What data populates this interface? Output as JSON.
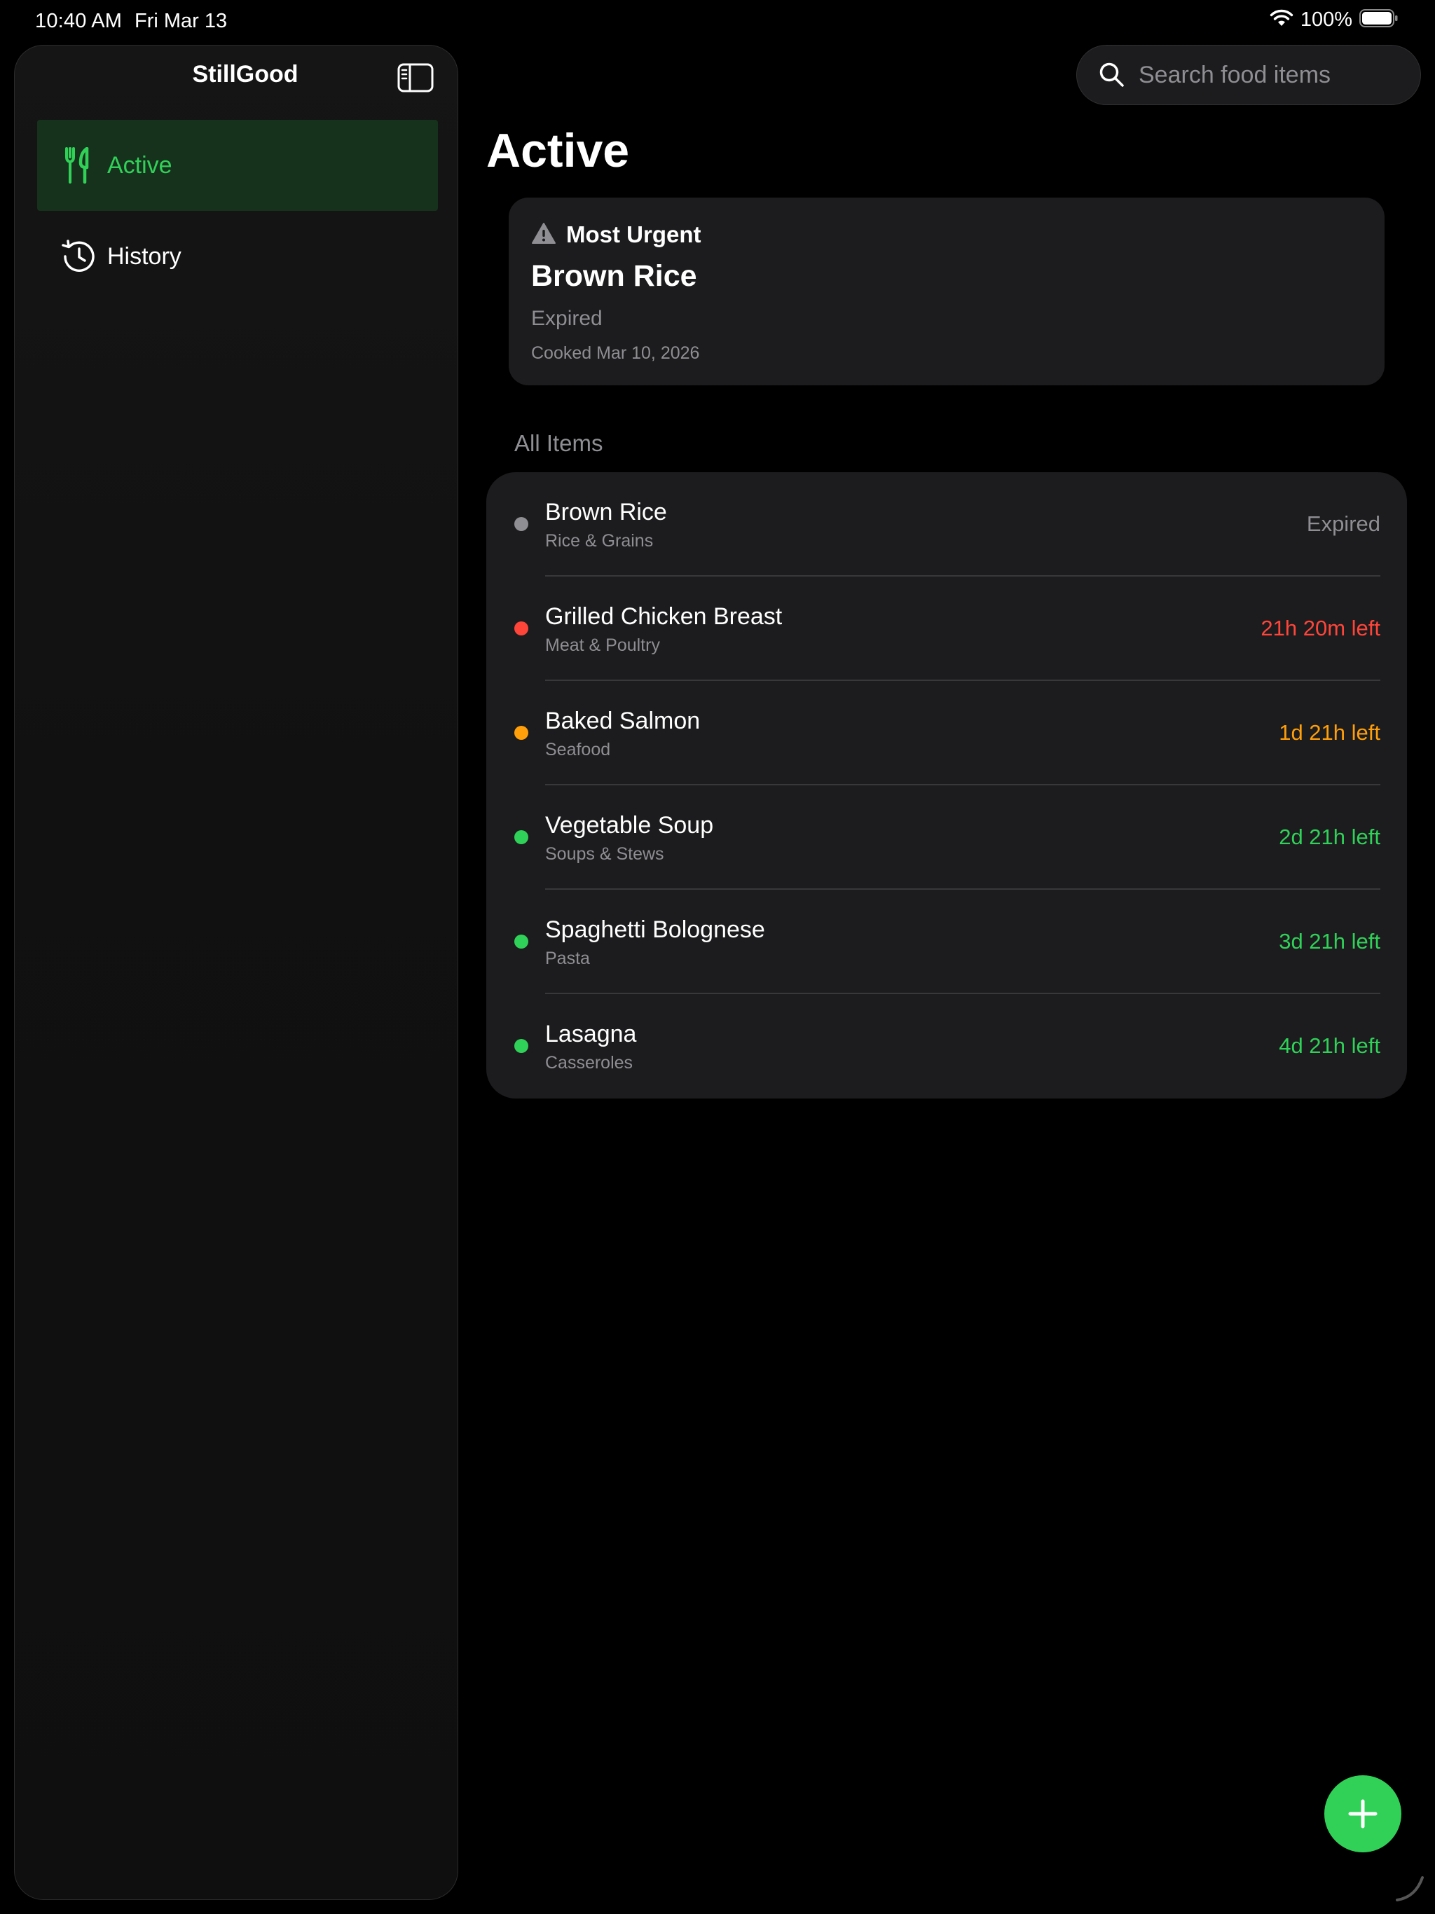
{
  "status_bar": {
    "time": "10:40 AM",
    "date": "Fri Mar 13",
    "battery": "100%"
  },
  "sidebar": {
    "title": "StillGood",
    "items": [
      {
        "label": "Active",
        "icon": "fork-knife-icon",
        "selected": true
      },
      {
        "label": "History",
        "icon": "history-icon",
        "selected": false
      }
    ]
  },
  "search": {
    "placeholder": "Search food items"
  },
  "main": {
    "title": "Active",
    "urgent": {
      "header": "Most Urgent",
      "name": "Brown Rice",
      "status": "Expired",
      "cooked": "Cooked Mar 10, 2026"
    },
    "section_title": "All Items",
    "items": [
      {
        "name": "Brown Rice",
        "category": "Rice & Grains",
        "time": "Expired",
        "color": "#8e8e93"
      },
      {
        "name": "Grilled Chicken Breast",
        "category": "Meat & Poultry",
        "time": "21h 20m left",
        "color": "#ff453a"
      },
      {
        "name": "Baked Salmon",
        "category": "Seafood",
        "time": "1d 21h left",
        "color": "#ff9f0a"
      },
      {
        "name": "Vegetable Soup",
        "category": "Soups & Stews",
        "time": "2d 21h left",
        "color": "#30d158"
      },
      {
        "name": "Spaghetti Bolognese",
        "category": "Pasta",
        "time": "3d 21h left",
        "color": "#30d158"
      },
      {
        "name": "Lasagna",
        "category": "Casseroles",
        "time": "4d 21h left",
        "color": "#30d158"
      }
    ]
  },
  "colors": {
    "accent": "#31d158",
    "background": "#000000",
    "card": "#1c1c1e"
  }
}
